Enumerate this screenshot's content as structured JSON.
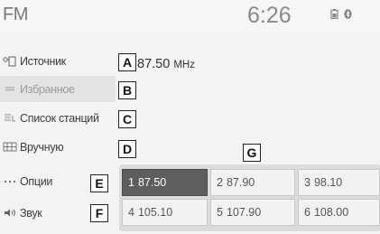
{
  "header": {
    "title": "FM",
    "clock": "6:26",
    "icons": [
      "phone-battery-icon",
      "bluetooth-icon"
    ]
  },
  "sidebar": {
    "items": [
      {
        "label": "Источник",
        "icon": "source-icon",
        "active": false
      },
      {
        "label": "Избранное",
        "icon": "favorites-icon",
        "active": true
      },
      {
        "label": "Список станций",
        "icon": "station-list-icon",
        "active": false
      },
      {
        "label": "Вручную",
        "icon": "manual-tune-icon",
        "active": false
      },
      {
        "label": "Опции",
        "icon": "more-options-icon",
        "active": false
      },
      {
        "label": "Звук",
        "icon": "speaker-icon",
        "active": false
      }
    ]
  },
  "tuner": {
    "frequency": "87.50",
    "unit": "MHz"
  },
  "presets": [
    {
      "num": "1",
      "freq": "87.50",
      "selected": true
    },
    {
      "num": "2",
      "freq": "87.90",
      "selected": false
    },
    {
      "num": "3",
      "freq": "98.10",
      "selected": false
    },
    {
      "num": "4",
      "freq": "105.10",
      "selected": false
    },
    {
      "num": "5",
      "freq": "107.90",
      "selected": false
    },
    {
      "num": "6",
      "freq": "108.00",
      "selected": false
    }
  ],
  "callouts": [
    "A",
    "B",
    "C",
    "D",
    "E",
    "F",
    "G"
  ],
  "colors": {
    "background": "#f3f3f3",
    "selected_preset": "#5e5e5e",
    "active_menu": "#e3e3e3"
  }
}
